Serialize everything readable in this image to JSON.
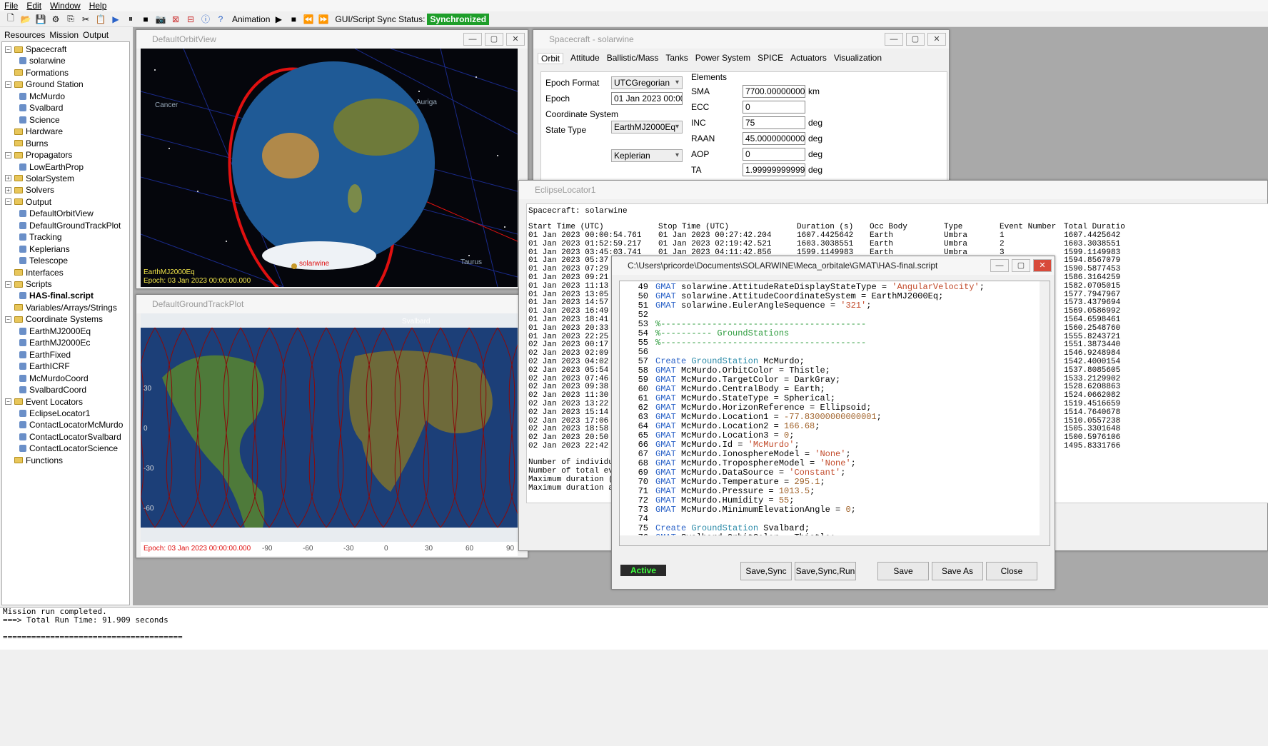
{
  "menu": [
    "File",
    "Edit",
    "Window",
    "Help"
  ],
  "toolbar": {
    "animation_label": "Animation",
    "sync_label": "GUI/Script Sync Status:",
    "sync_value": "Synchronized"
  },
  "left_tabs": [
    "Resources",
    "Mission",
    "Output"
  ],
  "tree": [
    {
      "label": "Spacecraft",
      "level": 0,
      "type": "folder",
      "exp": "−"
    },
    {
      "label": "solarwine",
      "level": 1,
      "type": "leaf"
    },
    {
      "label": "Formations",
      "level": 0,
      "type": "folder"
    },
    {
      "label": "Ground Station",
      "level": 0,
      "type": "folder",
      "exp": "−"
    },
    {
      "label": "McMurdo",
      "level": 1,
      "type": "leaf"
    },
    {
      "label": "Svalbard",
      "level": 1,
      "type": "leaf"
    },
    {
      "label": "Science",
      "level": 1,
      "type": "leaf"
    },
    {
      "label": "Hardware",
      "level": 0,
      "type": "folder"
    },
    {
      "label": "Burns",
      "level": 0,
      "type": "folder"
    },
    {
      "label": "Propagators",
      "level": 0,
      "type": "folder",
      "exp": "−"
    },
    {
      "label": "LowEarthProp",
      "level": 1,
      "type": "leaf"
    },
    {
      "label": "SolarSystem",
      "level": 0,
      "type": "folder",
      "exp": "+"
    },
    {
      "label": "Solvers",
      "level": 0,
      "type": "folder",
      "exp": "+"
    },
    {
      "label": "Output",
      "level": 0,
      "type": "folder",
      "exp": "−"
    },
    {
      "label": "DefaultOrbitView",
      "level": 1,
      "type": "leaf"
    },
    {
      "label": "DefaultGroundTrackPlot",
      "level": 1,
      "type": "leaf"
    },
    {
      "label": "Tracking",
      "level": 1,
      "type": "leaf"
    },
    {
      "label": "Keplerians",
      "level": 1,
      "type": "leaf"
    },
    {
      "label": "Telescope",
      "level": 1,
      "type": "leaf"
    },
    {
      "label": "Interfaces",
      "level": 0,
      "type": "folder"
    },
    {
      "label": "Scripts",
      "level": 0,
      "type": "folder",
      "exp": "−"
    },
    {
      "label": "HAS-final.script",
      "level": 1,
      "type": "leaf",
      "bold": true
    },
    {
      "label": "Variables/Arrays/Strings",
      "level": 0,
      "type": "folder"
    },
    {
      "label": "Coordinate Systems",
      "level": 0,
      "type": "folder",
      "exp": "−"
    },
    {
      "label": "EarthMJ2000Eq",
      "level": 1,
      "type": "leaf"
    },
    {
      "label": "EarthMJ2000Ec",
      "level": 1,
      "type": "leaf"
    },
    {
      "label": "EarthFixed",
      "level": 1,
      "type": "leaf"
    },
    {
      "label": "EarthICRF",
      "level": 1,
      "type": "leaf"
    },
    {
      "label": "McMurdoCoord",
      "level": 1,
      "type": "leaf"
    },
    {
      "label": "SvalbardCoord",
      "level": 1,
      "type": "leaf"
    },
    {
      "label": "Event Locators",
      "level": 0,
      "type": "folder",
      "exp": "−"
    },
    {
      "label": "EclipseLocator1",
      "level": 1,
      "type": "leaf"
    },
    {
      "label": "ContactLocatorMcMurdo",
      "level": 1,
      "type": "leaf"
    },
    {
      "label": "ContactLocatorSvalbard",
      "level": 1,
      "type": "leaf"
    },
    {
      "label": "ContactLocatorScience",
      "level": 1,
      "type": "leaf"
    },
    {
      "label": "Functions",
      "level": 0,
      "type": "folder"
    }
  ],
  "orbitview": {
    "title": "DefaultOrbitView",
    "cs": "EarthMJ2000Eq",
    "epoch": "Epoch: 03 Jan 2023 00:00:00.000",
    "labels": [
      "Cancer",
      "Auriga",
      "Taurus",
      "solarwine"
    ]
  },
  "groundtrack": {
    "title": "DefaultGroundTrackPlot",
    "epoch": "Epoch: 03 Jan 2023 00:00:00.000",
    "station": "Svalbard",
    "xticks": [
      "-90",
      "-60",
      "-30",
      "0",
      "30",
      "60",
      "90"
    ],
    "yticks": [
      "30",
      "0",
      "-30",
      "-60"
    ]
  },
  "spacecraft": {
    "title": "Spacecraft - solarwine",
    "tabs": [
      "Orbit",
      "Attitude",
      "Ballistic/Mass",
      "Tanks",
      "Power System",
      "SPICE",
      "Actuators",
      "Visualization"
    ],
    "epoch_format_label": "Epoch Format",
    "epoch_format": "UTCGregorian",
    "epoch_label": "Epoch",
    "epoch": "01 Jan 2023 00:00:0",
    "cs_label": "Coordinate System",
    "cs": "EarthMJ2000Eq",
    "state_label": "State Type",
    "state": "Keplerian",
    "elements_label": "Elements",
    "elements": [
      {
        "name": "SMA",
        "value": "7700.000000000",
        "unit": "km"
      },
      {
        "name": "ECC",
        "value": "0",
        "unit": ""
      },
      {
        "name": "INC",
        "value": "75",
        "unit": "deg"
      },
      {
        "name": "RAAN",
        "value": "45.00000000000",
        "unit": "deg"
      },
      {
        "name": "AOP",
        "value": "0",
        "unit": "deg"
      },
      {
        "name": "TA",
        "value": "1.999999999999",
        "unit": "deg"
      }
    ]
  },
  "eclipse": {
    "title": "EclipseLocator1",
    "spacecraft_line": "Spacecraft: solarwine",
    "headers": [
      "Start Time (UTC)",
      "Stop Time (UTC)",
      "Duration (s)",
      "Occ Body",
      "Type",
      "Event Number",
      "Total Duratio"
    ],
    "rows": [
      [
        "01 Jan 2023 00:00:54.761",
        "01 Jan 2023 00:27:42.204",
        "1607.4425642",
        "Earth",
        "Umbra",
        "1",
        "1607.4425642"
      ],
      [
        "01 Jan 2023 01:52:59.217",
        "01 Jan 2023 02:19:42.521",
        "1603.3038551",
        "Earth",
        "Umbra",
        "2",
        "1603.3038551"
      ],
      [
        "01 Jan 2023 03:45:03.741",
        "01 Jan 2023 04:11:42.856",
        "1599.1149983",
        "Earth",
        "Umbra",
        "3",
        "1599.1149983"
      ]
    ],
    "starts": [
      "01 Jan 2023 05:37",
      "01 Jan 2023 07:29",
      "01 Jan 2023 09:21",
      "01 Jan 2023 11:13",
      "01 Jan 2023 13:05",
      "01 Jan 2023 14:57",
      "01 Jan 2023 16:49",
      "01 Jan 2023 18:41",
      "01 Jan 2023 20:33",
      "01 Jan 2023 22:25",
      "02 Jan 2023 00:17",
      "02 Jan 2023 02:09",
      "02 Jan 2023 04:02",
      "02 Jan 2023 05:54",
      "02 Jan 2023 07:46",
      "02 Jan 2023 09:38",
      "02 Jan 2023 11:30",
      "02 Jan 2023 13:22",
      "02 Jan 2023 15:14",
      "02 Jan 2023 17:06",
      "02 Jan 2023 18:58",
      "02 Jan 2023 20:50",
      "02 Jan 2023 22:42"
    ],
    "totals": [
      "1594.8567079",
      "1590.5877453",
      "1586.3164259",
      "1582.0705015",
      "1577.7947967",
      "1573.4379694",
      "1569.0586992",
      "1564.6598461",
      "1560.2548760",
      "1555.8243721",
      "1551.3873440",
      "1546.9248984",
      "1542.4000154",
      "1537.8085605",
      "1533.2129902",
      "1528.6208863",
      "1524.0662082",
      "1519.4516659",
      "1514.7640678",
      "1510.0557238",
      "1505.3301648",
      "1500.5976106",
      "1495.8331766"
    ],
    "summary": [
      "Number of individu",
      "Number of total ev",
      "Maximum duration (",
      "Maximum duration a"
    ]
  },
  "script": {
    "title": "C:\\Users\\pricorde\\Documents\\SOLARWINE\\Meca_orbitale\\GMAT\\HAS-final.script",
    "lines": [
      {
        "n": "49",
        "t": "GMAT solarwine.AttitudeRateDisplayStateType = 'AngularVelocity';"
      },
      {
        "n": "50",
        "t": "GMAT solarwine.AttitudeCoordinateSystem = EarthMJ2000Eq;"
      },
      {
        "n": "51",
        "t": "GMAT solarwine.EulerAngleSequence = '321';"
      },
      {
        "n": "52",
        "t": ""
      },
      {
        "n": "53",
        "t": "%----------------------------------------"
      },
      {
        "n": "54",
        "t": "%---------- GroundStations"
      },
      {
        "n": "55",
        "t": "%----------------------------------------"
      },
      {
        "n": "56",
        "t": ""
      },
      {
        "n": "57",
        "t": "Create GroundStation McMurdo;"
      },
      {
        "n": "58",
        "t": "GMAT McMurdo.OrbitColor = Thistle;"
      },
      {
        "n": "59",
        "t": "GMAT McMurdo.TargetColor = DarkGray;"
      },
      {
        "n": "60",
        "t": "GMAT McMurdo.CentralBody = Earth;"
      },
      {
        "n": "61",
        "t": "GMAT McMurdo.StateType = Spherical;"
      },
      {
        "n": "62",
        "t": "GMAT McMurdo.HorizonReference = Ellipsoid;"
      },
      {
        "n": "63",
        "t": "GMAT McMurdo.Location1 = -77.83000000000001;"
      },
      {
        "n": "64",
        "t": "GMAT McMurdo.Location2 = 166.68;"
      },
      {
        "n": "65",
        "t": "GMAT McMurdo.Location3 = 0;"
      },
      {
        "n": "66",
        "t": "GMAT McMurdo.Id = 'McMurdo';"
      },
      {
        "n": "67",
        "t": "GMAT McMurdo.IonosphereModel = 'None';"
      },
      {
        "n": "68",
        "t": "GMAT McMurdo.TroposphereModel = 'None';"
      },
      {
        "n": "69",
        "t": "GMAT McMurdo.DataSource = 'Constant';"
      },
      {
        "n": "70",
        "t": "GMAT McMurdo.Temperature = 295.1;"
      },
      {
        "n": "71",
        "t": "GMAT McMurdo.Pressure = 1013.5;"
      },
      {
        "n": "72",
        "t": "GMAT McMurdo.Humidity = 55;"
      },
      {
        "n": "73",
        "t": "GMAT McMurdo.MinimumElevationAngle = 0;"
      },
      {
        "n": "74",
        "t": ""
      },
      {
        "n": "75",
        "t": "Create GroundStation Svalbard;"
      },
      {
        "n": "76",
        "t": "GMAT Svalbard.OrbitColor = Thistle;"
      }
    ],
    "status": "Active",
    "buttons": [
      "Save,Sync",
      "Save,Sync,Run",
      "Save",
      "Save As",
      "Close"
    ]
  },
  "console": {
    "lines": [
      "Mission run completed.",
      "===> Total Run Time: 91.909 seconds",
      "",
      "======================================"
    ]
  }
}
